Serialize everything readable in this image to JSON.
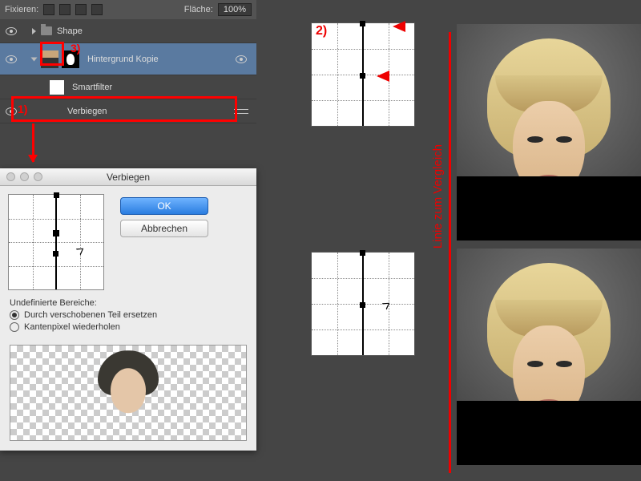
{
  "layers_panel": {
    "lock_label": "Fixieren:",
    "fill_label": "Fläche:",
    "fill_value": "100%",
    "rows": {
      "shape": "Shape",
      "bg_copy": "Hintergrund Kopie",
      "smartfilter": "Smartfilter",
      "verbiegen": "Verbiegen"
    }
  },
  "annotations": {
    "step1": "1)",
    "step2": "2)",
    "step3": "3)",
    "compare_line": "Linie zum Vergleich"
  },
  "dialog": {
    "title": "Verbiegen",
    "ok": "OK",
    "cancel": "Abbrechen",
    "undef_label": "Undefinierte Bereiche:",
    "opt_shift": "Durch verschobenen Teil ersetzen",
    "opt_edge": "Kantenpixel wiederholen"
  }
}
